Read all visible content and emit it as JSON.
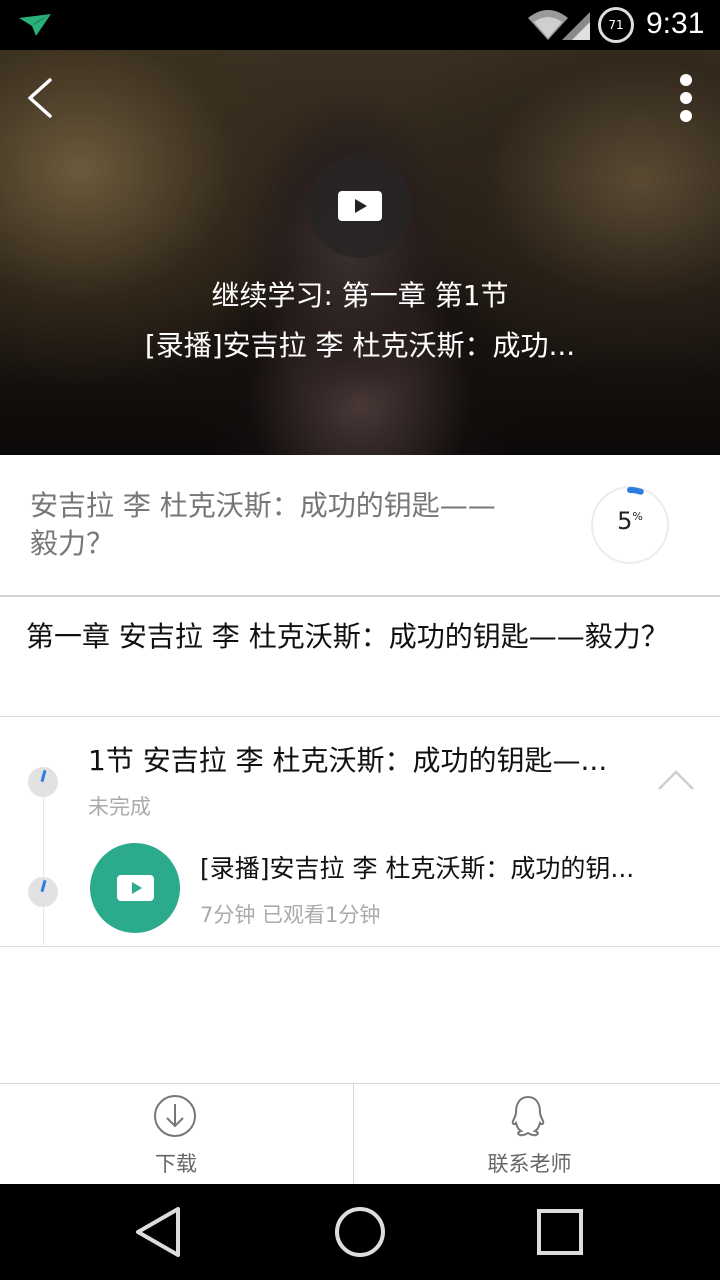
{
  "status_bar": {
    "time": "9:31",
    "battery": "71",
    "icons": [
      "app-notification-icon",
      "wifi-icon",
      "signal-icon",
      "battery-icon"
    ]
  },
  "hero": {
    "continue_label": "继续学习: 第一章 第1节",
    "lesson_title": "[录播]安吉拉 李 杜克沃斯：成功...",
    "icons": [
      "back-arrow-icon",
      "more-vertical-icon",
      "play-icon"
    ]
  },
  "course": {
    "title": "安吉拉 李 杜克沃斯：成功的钥匙——毅力？",
    "progress_value": "5",
    "progress_unit": "%",
    "progress_fraction": 0.05,
    "accent_color": "#2b7de0"
  },
  "chapter": {
    "title": "第一章 安吉拉 李 杜克沃斯：成功的钥匙——毅力？"
  },
  "section": {
    "title": "1节  安吉拉 李 杜克沃斯：成功的钥匙—...",
    "status": "未完成",
    "lesson": {
      "title": "[录播]安吉拉 李 杜克沃斯：成功的钥...",
      "meta": "7分钟 已观看1分钟",
      "thumb_color": "#2bab8c"
    }
  },
  "bottom_bar": {
    "download_label": "下载",
    "contact_label": "联系老师"
  },
  "nav_bar": {
    "icons": [
      "nav-back-icon",
      "nav-home-icon",
      "nav-recents-icon"
    ]
  }
}
